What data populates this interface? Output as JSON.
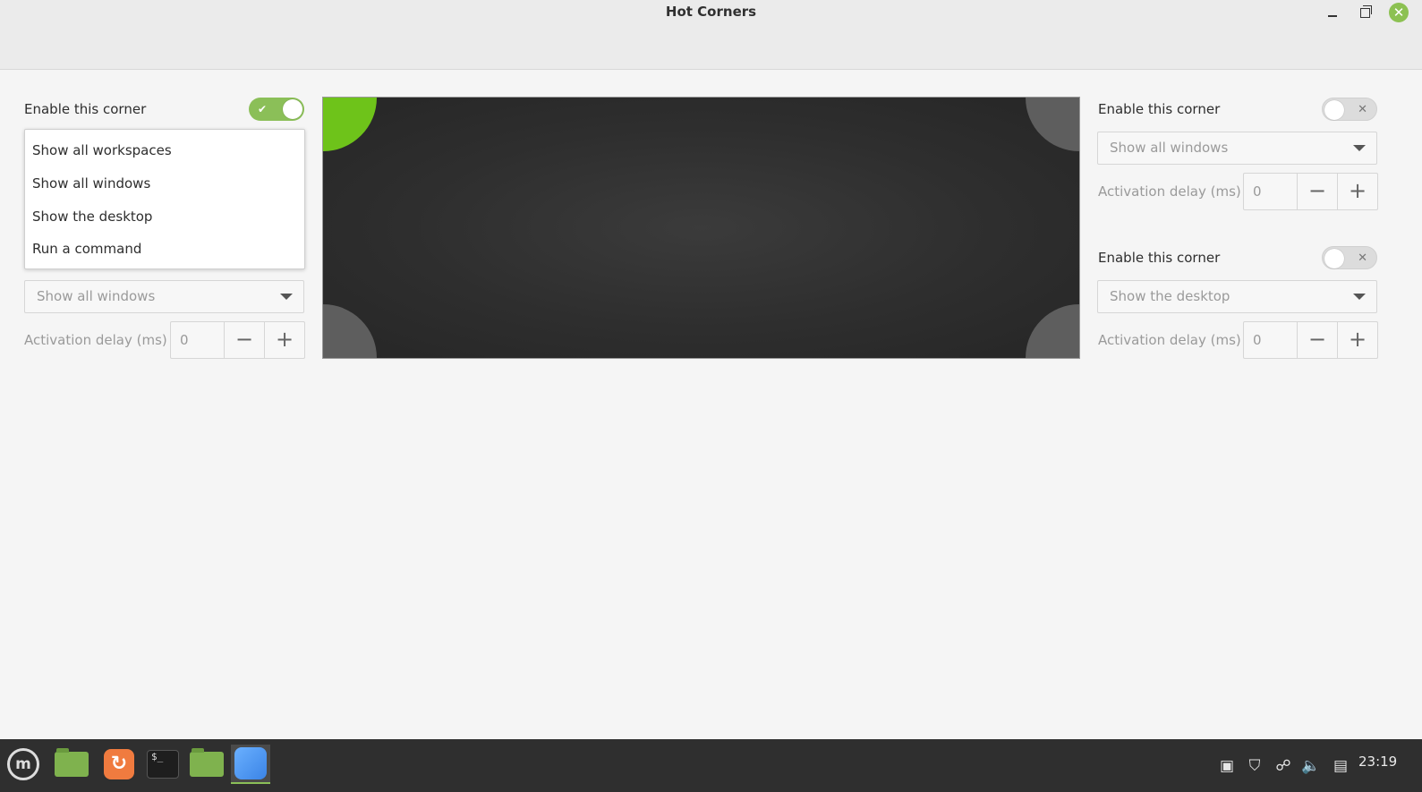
{
  "window": {
    "title": "Hot Corners"
  },
  "corners": {
    "top_left": {
      "enable_label": "Enable this corner",
      "enabled": true,
      "action": "Show all windows",
      "delay_label": "Activation delay (ms)",
      "delay_value": "0"
    },
    "top_right": {
      "enable_label": "Enable this corner",
      "enabled": false,
      "action": "Show all windows",
      "delay_label": "Activation delay (ms)",
      "delay_value": "0"
    },
    "bottom_right": {
      "enable_label": "Enable this corner",
      "enabled": false,
      "action": "Show the desktop",
      "delay_label": "Activation delay (ms)",
      "delay_value": "0"
    }
  },
  "dropdown_menu": {
    "items": [
      "Show all workspaces",
      "Show all windows",
      "Show the desktop",
      "Run a command"
    ]
  },
  "spin": {
    "minus": "−",
    "plus": "+"
  },
  "toggle": {
    "on_mark": "✔",
    "off_mark": "✕"
  },
  "preview": {
    "active_color": "#6ec31a",
    "inactive_color": "#5e5e5e"
  },
  "taskbar": {
    "menu_logo": "m",
    "browser_glyph": "↻",
    "terminal_glyph": "$_",
    "clock": "23:19",
    "icons": [
      "menu-icon",
      "files-icon",
      "browser-icon",
      "terminal-icon",
      "folder-icon",
      "settings-icon"
    ],
    "tray_icons": [
      "clipboard-icon",
      "shield-icon",
      "network-icon",
      "volume-icon",
      "battery-icon"
    ]
  },
  "colors": {
    "accent_green": "#8bbf58",
    "titlebar_close": "#8cc152"
  }
}
